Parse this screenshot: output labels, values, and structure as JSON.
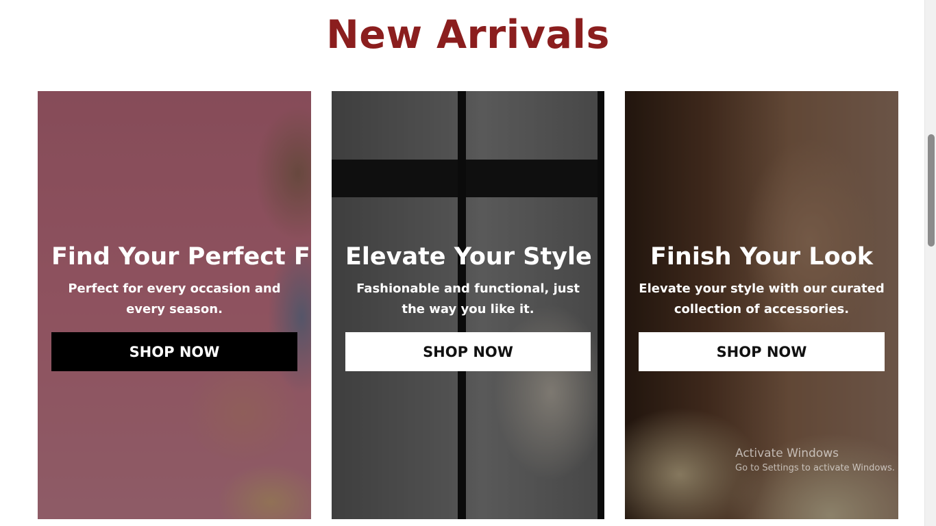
{
  "section": {
    "title": "New Arrivals"
  },
  "cards": [
    {
      "title": "Find Your Perfect Fit",
      "description": "Perfect for every occasion and every season.",
      "button_label": "SHOP NOW",
      "button_style": "dark"
    },
    {
      "title": "Elevate Your Style",
      "description": "Fashionable and functional, just the way you like it.",
      "button_label": "SHOP NOW",
      "button_style": "light"
    },
    {
      "title": "Finish Your Look",
      "description": "Elevate your style with our curated collection of accessories.",
      "button_label": "SHOP NOW",
      "button_style": "light"
    }
  ],
  "watermark": {
    "title": "Activate Windows",
    "subtitle": "Go to Settings to activate Windows."
  },
  "colors": {
    "title": "#8b1e1e",
    "dark_button": "#000000",
    "light_button": "#ffffff"
  }
}
